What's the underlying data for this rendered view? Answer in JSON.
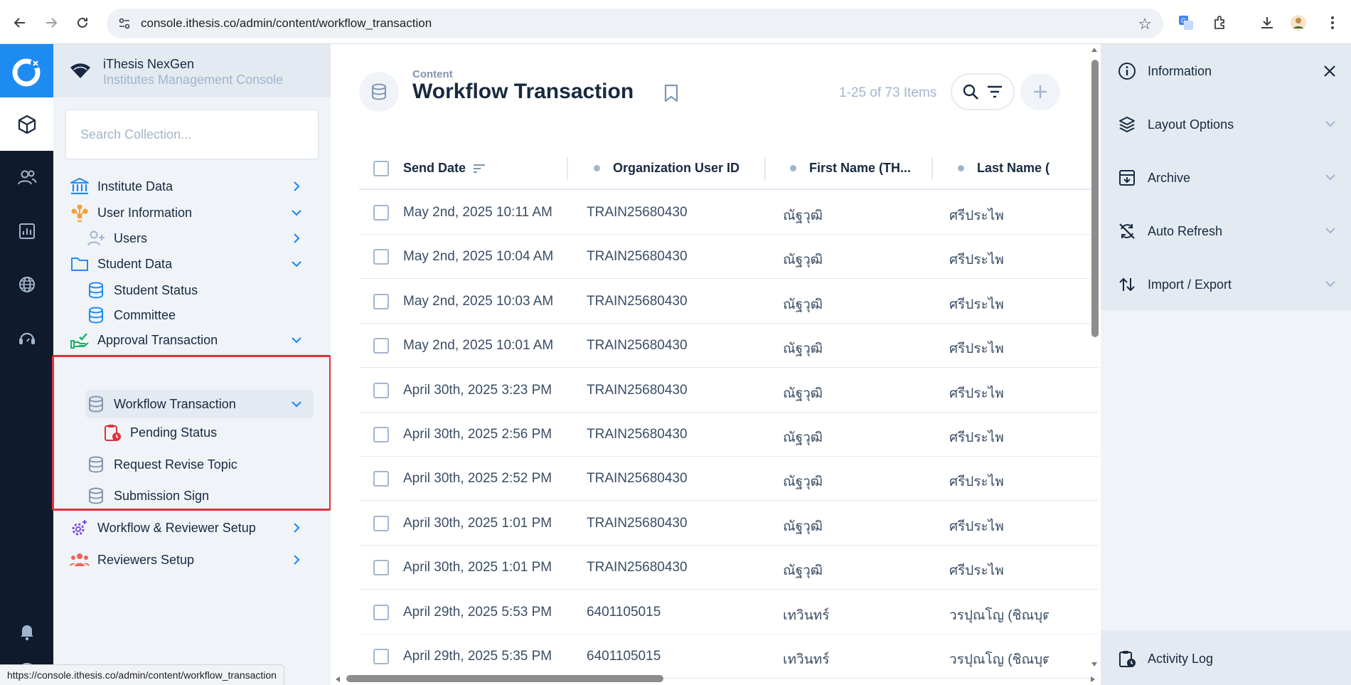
{
  "browser": {
    "url": "console.ithesis.co/admin/content/workflow_transaction"
  },
  "app": {
    "project_name": "iThesis NexGen",
    "project_desc": "Institutes Management Console"
  },
  "nav": {
    "search_placeholder": "Search Collection...",
    "items": [
      {
        "label": "Institute Data"
      },
      {
        "label": "User Information"
      },
      {
        "label": "Users"
      },
      {
        "label": "Student Data"
      },
      {
        "label": "Student Status"
      },
      {
        "label": "Committee"
      },
      {
        "label": "Approval Transaction"
      },
      {
        "label": "Workflow Transaction"
      },
      {
        "label": "Pending Status"
      },
      {
        "label": "Request Revise Topic"
      },
      {
        "label": "Submission Sign"
      },
      {
        "label": "Workflow & Reviewer Setup"
      },
      {
        "label": "Reviewers Setup"
      }
    ]
  },
  "header": {
    "breadcrumb": "Content",
    "title": "Workflow Transaction",
    "item_count": "1-25 of 73 Items"
  },
  "table": {
    "columns": [
      "Send Date",
      "Organization User ID",
      "First Name (TH...",
      "Last Name ("
    ],
    "rows": [
      [
        "May 2nd, 2025 10:11 AM",
        "TRAIN25680430",
        "ณัฐวุฒิ",
        "ศรีประไพ"
      ],
      [
        "May 2nd, 2025 10:04 AM",
        "TRAIN25680430",
        "ณัฐวุฒิ",
        "ศรีประไพ"
      ],
      [
        "May 2nd, 2025 10:03 AM",
        "TRAIN25680430",
        "ณัฐวุฒิ",
        "ศรีประไพ"
      ],
      [
        "May 2nd, 2025 10:01 AM",
        "TRAIN25680430",
        "ณัฐวุฒิ",
        "ศรีประไพ"
      ],
      [
        "April 30th, 2025 3:23 PM",
        "TRAIN25680430",
        "ณัฐวุฒิ",
        "ศรีประไพ"
      ],
      [
        "April 30th, 2025 2:56 PM",
        "TRAIN25680430",
        "ณัฐวุฒิ",
        "ศรีประไพ"
      ],
      [
        "April 30th, 2025 2:52 PM",
        "TRAIN25680430",
        "ณัฐวุฒิ",
        "ศรีประไพ"
      ],
      [
        "April 30th, 2025 1:01 PM",
        "TRAIN25680430",
        "ณัฐวุฒิ",
        "ศรีประไพ"
      ],
      [
        "April 30th, 2025 1:01 PM",
        "TRAIN25680430",
        "ณัฐวุฒิ",
        "ศรีประไพ"
      ],
      [
        "April 29th, 2025 5:53 PM",
        "6401105015",
        "เทวินทร์",
        "วรปุณโญ (ชิณบุต"
      ],
      [
        "April 29th, 2025 5:35 PM",
        "6401105015",
        "เทวินทร์",
        "วรปุณโญ (ชิณบุต"
      ]
    ]
  },
  "sidebar": {
    "information": "Information",
    "layout_options": "Layout Options",
    "archive": "Archive",
    "auto_refresh": "Auto Refresh",
    "import_export": "Import / Export",
    "activity_log": "Activity Log"
  },
  "status_bar": {
    "url": "https://console.ithesis.co/admin/content/workflow_transaction"
  },
  "colors": {
    "primary": "#1e8bf3",
    "module_bar": "#0f1b2d",
    "highlight_box": "#e0323b"
  }
}
